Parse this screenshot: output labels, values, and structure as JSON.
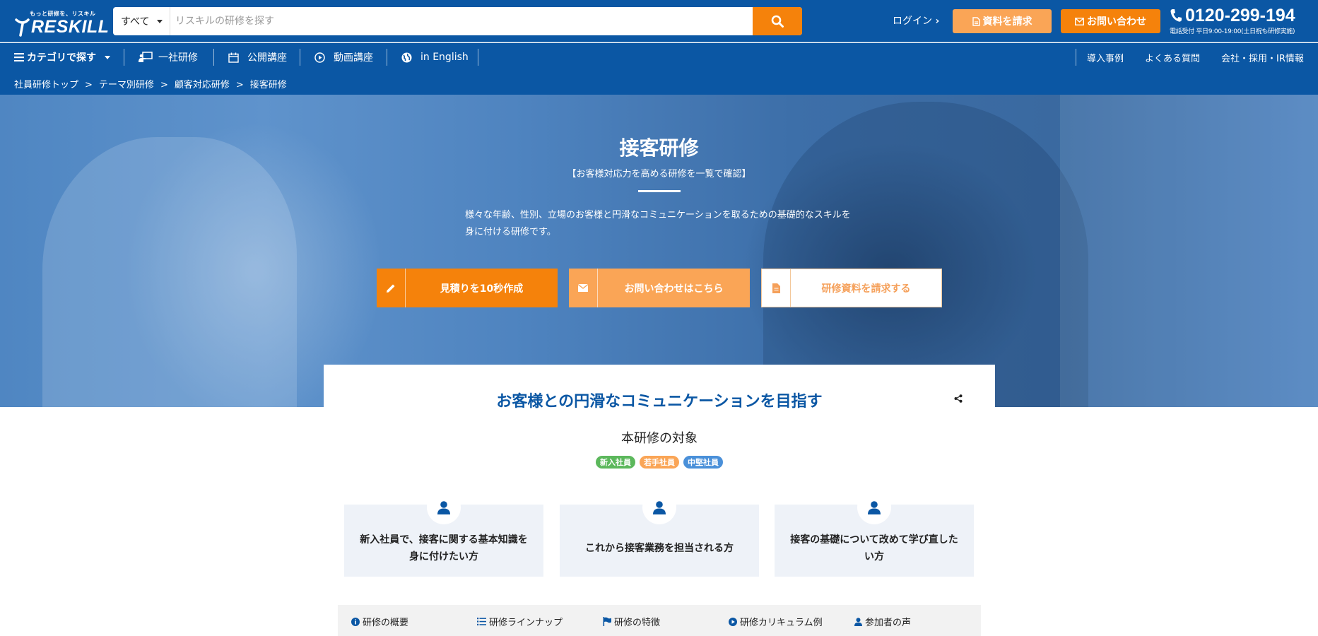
{
  "header": {
    "logo_tagline": "もっと研修を、リスキル",
    "logo_text": "RESKILL",
    "search_scope": "すべて",
    "search_placeholder": "リスキルの研修を探す",
    "login_label": "ログイン",
    "request_button": "資料を請求",
    "contact_button": "お問い合わせ",
    "phone_number": "0120-299-194",
    "phone_note": "電話受付 平日9:00-19:00(土日祝も研修実施)"
  },
  "nav": {
    "category": "カテゴリで探す",
    "items": [
      "一社研修",
      "公開講座",
      "動画講座",
      "in English"
    ],
    "right_items": [
      "導入事例",
      "よくある質問",
      "会社・採用・IR情報"
    ]
  },
  "breadcrumb": [
    "社員研修トップ",
    "テーマ別研修",
    "顧客対応研修",
    "接客研修"
  ],
  "hero": {
    "title": "接客研修",
    "subtitle": "【お客様対応力を高める研修を一覧で確認】",
    "description": "様々な年齢、性別、立場のお客様と円滑なコミュニケーションを取るための基礎的なスキルを身に付ける研修です。",
    "cta_estimate": "見積りを10秒作成",
    "cta_inquiry": "お問い合わせはこちら",
    "cta_document": "研修資料を請求する"
  },
  "content": {
    "heading": "お客様との円滑なコミュニケーションを目指す",
    "target_heading": "本研修の対象",
    "tags": [
      "新入社員",
      "若手社員",
      "中堅社員"
    ],
    "targets": [
      "新入社員で、接客に関する基本知識を身に付けたい方",
      "これから接客業務を担当される方",
      "接客の基礎について改めて学び直したい方"
    ],
    "tabs": [
      "研修の概要",
      "研修ラインナップ",
      "研修の特徴",
      "研修カリキュラム例",
      "参加者の声"
    ]
  },
  "colors": {
    "brand_blue": "#0b57a4",
    "accent_orange": "#f5820b",
    "light_orange": "#faa556"
  }
}
